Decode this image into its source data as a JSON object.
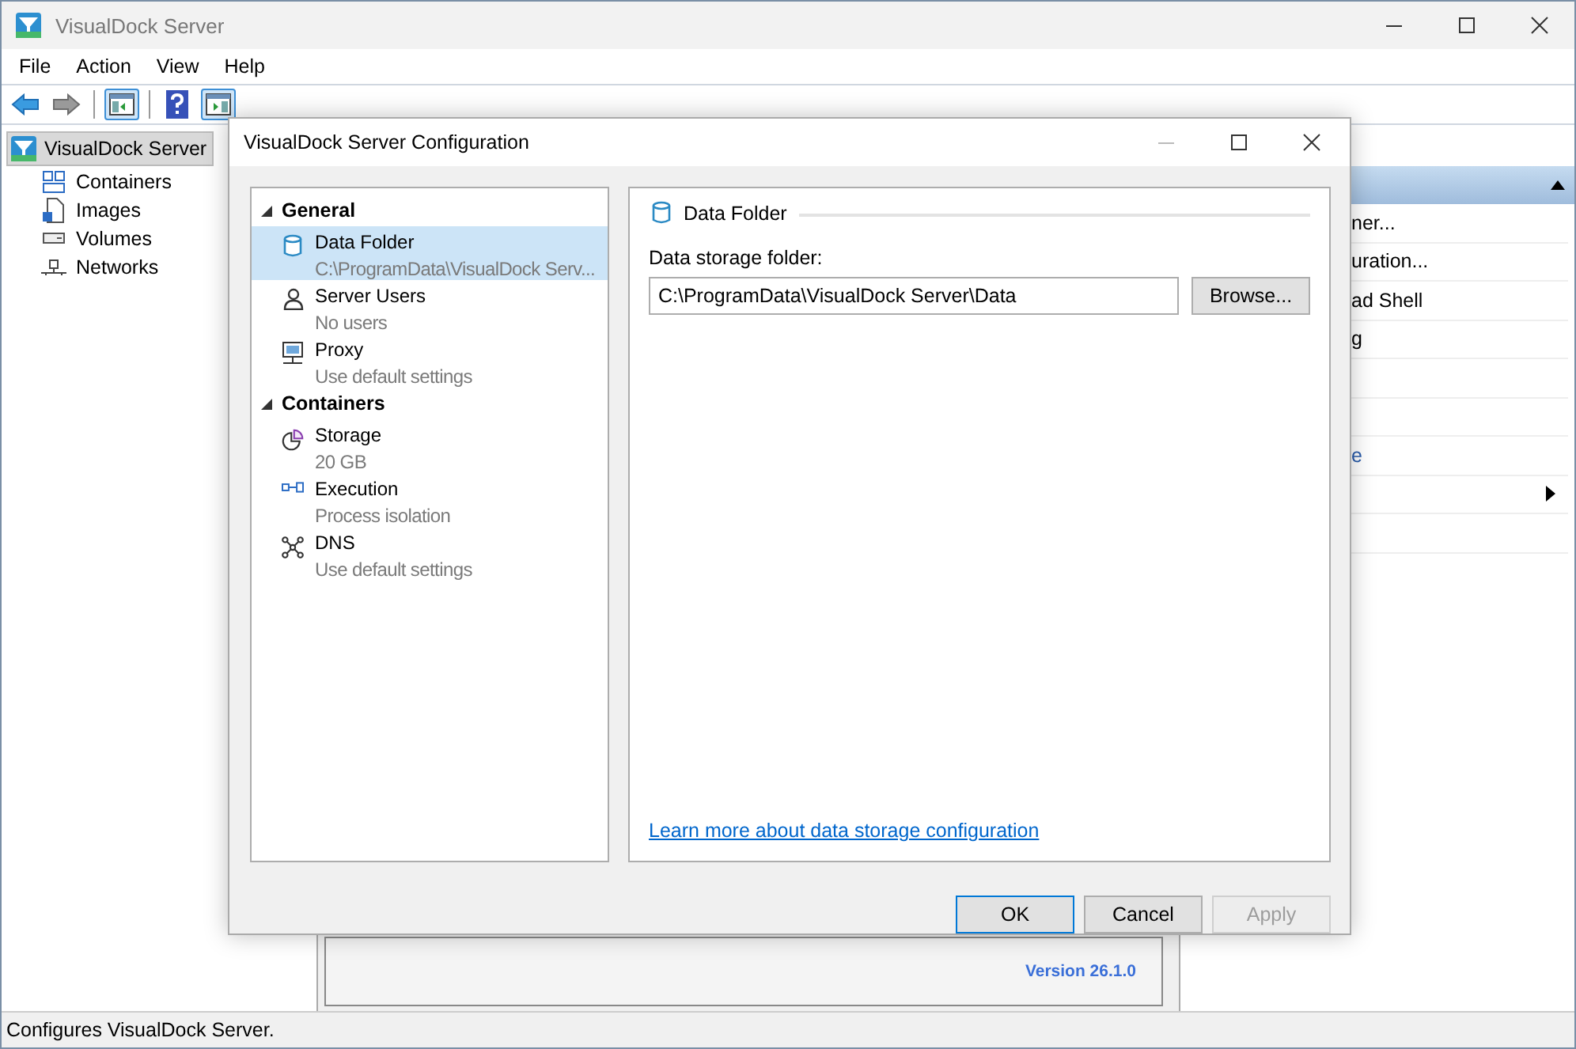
{
  "window": {
    "title": "VisualDock Server"
  },
  "menu": [
    "File",
    "Action",
    "View",
    "Help"
  ],
  "toolbar": [
    {
      "kind": "back"
    },
    {
      "kind": "forward"
    },
    {
      "kind": "separator"
    },
    {
      "kind": "pane-left",
      "selected": true
    },
    {
      "kind": "separator"
    },
    {
      "kind": "help"
    },
    {
      "kind": "pane-right",
      "selected": true
    }
  ],
  "tree": {
    "label": "VisualDock Server",
    "selected": true,
    "children": [
      {
        "label": "Containers",
        "kind": "containers"
      },
      {
        "label": "Images",
        "kind": "images"
      },
      {
        "label": "Volumes",
        "kind": "volumes"
      },
      {
        "label": "Networks",
        "kind": "networks"
      }
    ]
  },
  "center": {
    "version": "Version 26.1.0"
  },
  "actions": {
    "expanded": true,
    "items": [
      {
        "kind": "item",
        "text": "ner..."
      },
      {
        "kind": "item",
        "text": "uration..."
      },
      {
        "kind": "item",
        "text": "ad Shell"
      },
      {
        "kind": "item",
        "text": "g"
      },
      {
        "kind": "blank"
      },
      {
        "kind": "blank"
      },
      {
        "kind": "link",
        "text": "e"
      },
      {
        "kind": "submenu"
      },
      {
        "kind": "blank"
      }
    ]
  },
  "status_bar": "Configures VisualDock Server.",
  "dialog": {
    "title": "VisualDock Server Configuration",
    "nav": [
      {
        "label": "General",
        "expanded": true,
        "items": [
          {
            "kind": "cylinder",
            "title": "Data Folder",
            "subtitle": "C:\\ProgramData\\VisualDock Serv...",
            "selected": true
          },
          {
            "kind": "user",
            "title": "Server Users",
            "subtitle": "No users",
            "selected": false
          },
          {
            "kind": "monitor",
            "title": "Proxy",
            "subtitle": "Use default settings",
            "selected": false
          }
        ]
      },
      {
        "label": "Containers",
        "expanded": true,
        "items": [
          {
            "kind": "pie",
            "title": "Storage",
            "subtitle": "20 GB",
            "selected": false
          },
          {
            "kind": "link",
            "title": "Execution",
            "subtitle": "Process isolation",
            "selected": false
          },
          {
            "kind": "network",
            "title": "DNS",
            "subtitle": "Use default settings",
            "selected": false
          }
        ]
      }
    ],
    "panel": {
      "heading": "Data Folder",
      "field_label": "Data storage folder:",
      "field_value": "C:\\ProgramData\\VisualDock Server\\Data",
      "browse": "Browse...",
      "link": "Learn more about data storage configuration"
    },
    "buttons": [
      {
        "label": "OK",
        "default": true,
        "disabled": false
      },
      {
        "label": "Cancel",
        "default": false,
        "disabled": false
      },
      {
        "label": "Apply",
        "default": false,
        "disabled": true
      }
    ]
  }
}
